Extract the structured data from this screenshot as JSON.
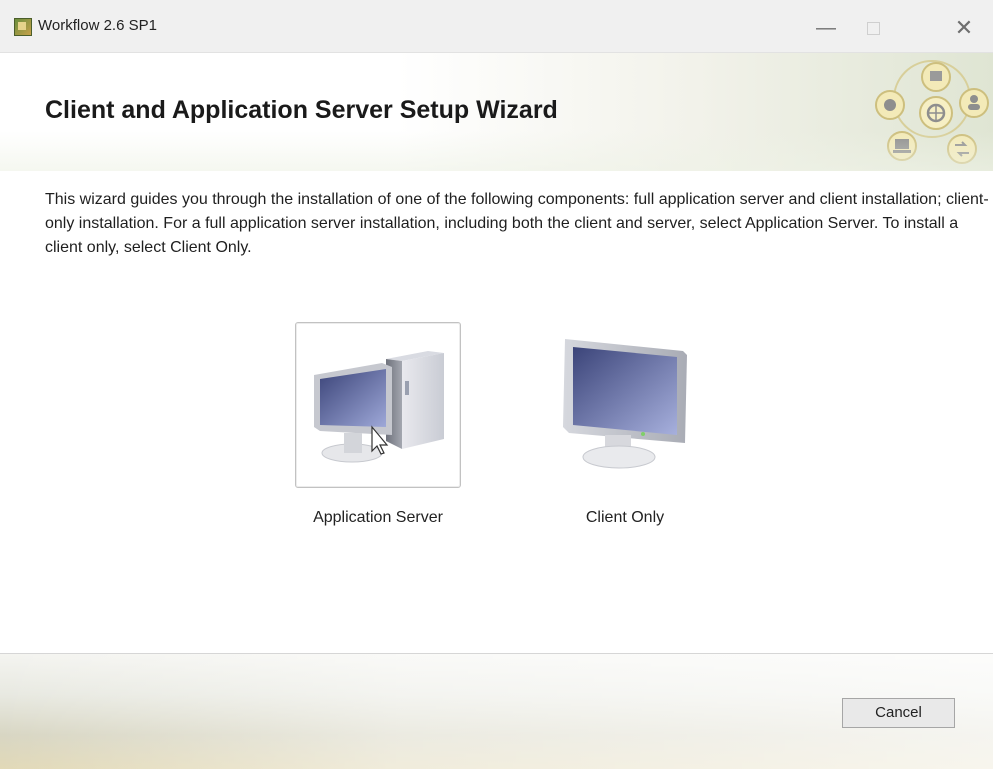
{
  "window": {
    "title": "Workflow 2.6 SP1",
    "controls": {
      "minimize": "—",
      "maximize": "",
      "close": "✕"
    }
  },
  "header": {
    "title": "Client and Application Server Setup Wizard",
    "logo_icon": "network-hub-icon"
  },
  "intro": {
    "text": "This wizard guides you through the installation of one of the following components: full application server and client installation; client-only installation. For a full application server installation, including both the client and server, select Application Server. To install a client only, select Client Only."
  },
  "options": [
    {
      "label": "Application Server",
      "icon": "server-and-monitor-icon",
      "selected": true
    },
    {
      "label": "Client Only",
      "icon": "monitor-icon",
      "selected": false
    }
  ],
  "footer": {
    "cancel_label": "Cancel"
  },
  "colors": {
    "header_tint": "#dfe5d3",
    "footer_tint": "#e2d9b7",
    "selection_border": "#c2c2c2"
  }
}
